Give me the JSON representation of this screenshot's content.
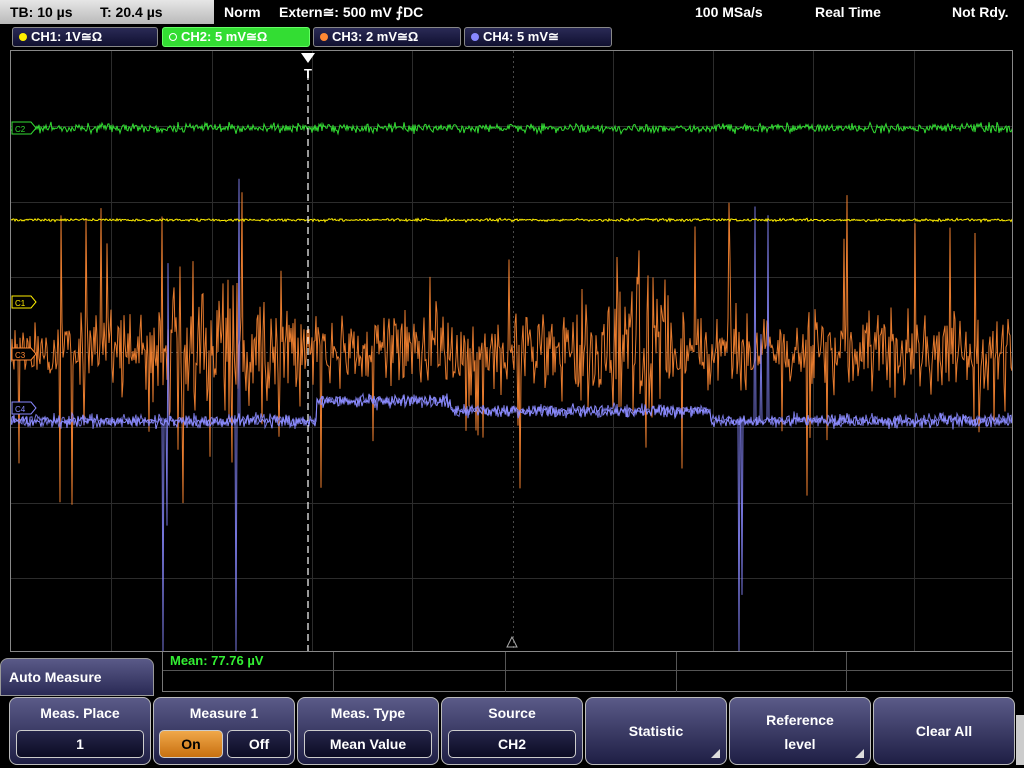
{
  "status": {
    "timebase": "TB: 10 µs",
    "trigger_time": "T: 20.4 µs",
    "trigger_mode": "Norm",
    "trigger_source": "Extern≅: 500 mV ⨍DC",
    "sample_rate": "100 MSa/s",
    "acq_mode": "Real Time",
    "state": "Not Rdy."
  },
  "channels": [
    {
      "label": "CH1: 1V≅Ω",
      "color": "#ffee00",
      "active": false
    },
    {
      "label": "CH2: 5 mV≅Ω",
      "color": "#33dd33",
      "active": true
    },
    {
      "label": "CH3: 2 mV≅Ω",
      "color": "#ff8833",
      "active": false
    },
    {
      "label": "CH4: 5 mV≅",
      "color": "#8888ff",
      "active": false
    }
  ],
  "markers": [
    "C2",
    "C1",
    "C3",
    "C4"
  ],
  "trigger_marker": "T",
  "measurement": {
    "mean": "Mean: 77.76 µV"
  },
  "menu": {
    "title": "Auto Measure",
    "meas_place": {
      "label": "Meas. Place",
      "value": "1"
    },
    "measure1": {
      "label": "Measure 1",
      "on": "On",
      "off": "Off"
    },
    "meas_type": {
      "label": "Meas. Type",
      "value": "Mean Value"
    },
    "source": {
      "label": "Source",
      "value": "CH2"
    },
    "statistic": "Statistic",
    "reference_level": {
      "line1": "Reference",
      "line2": "level"
    },
    "clear_all": "Clear All"
  },
  "icons": [
    "channel-dot-icon",
    "trigger-position-icon",
    "submenu-arrow-icon"
  ]
}
